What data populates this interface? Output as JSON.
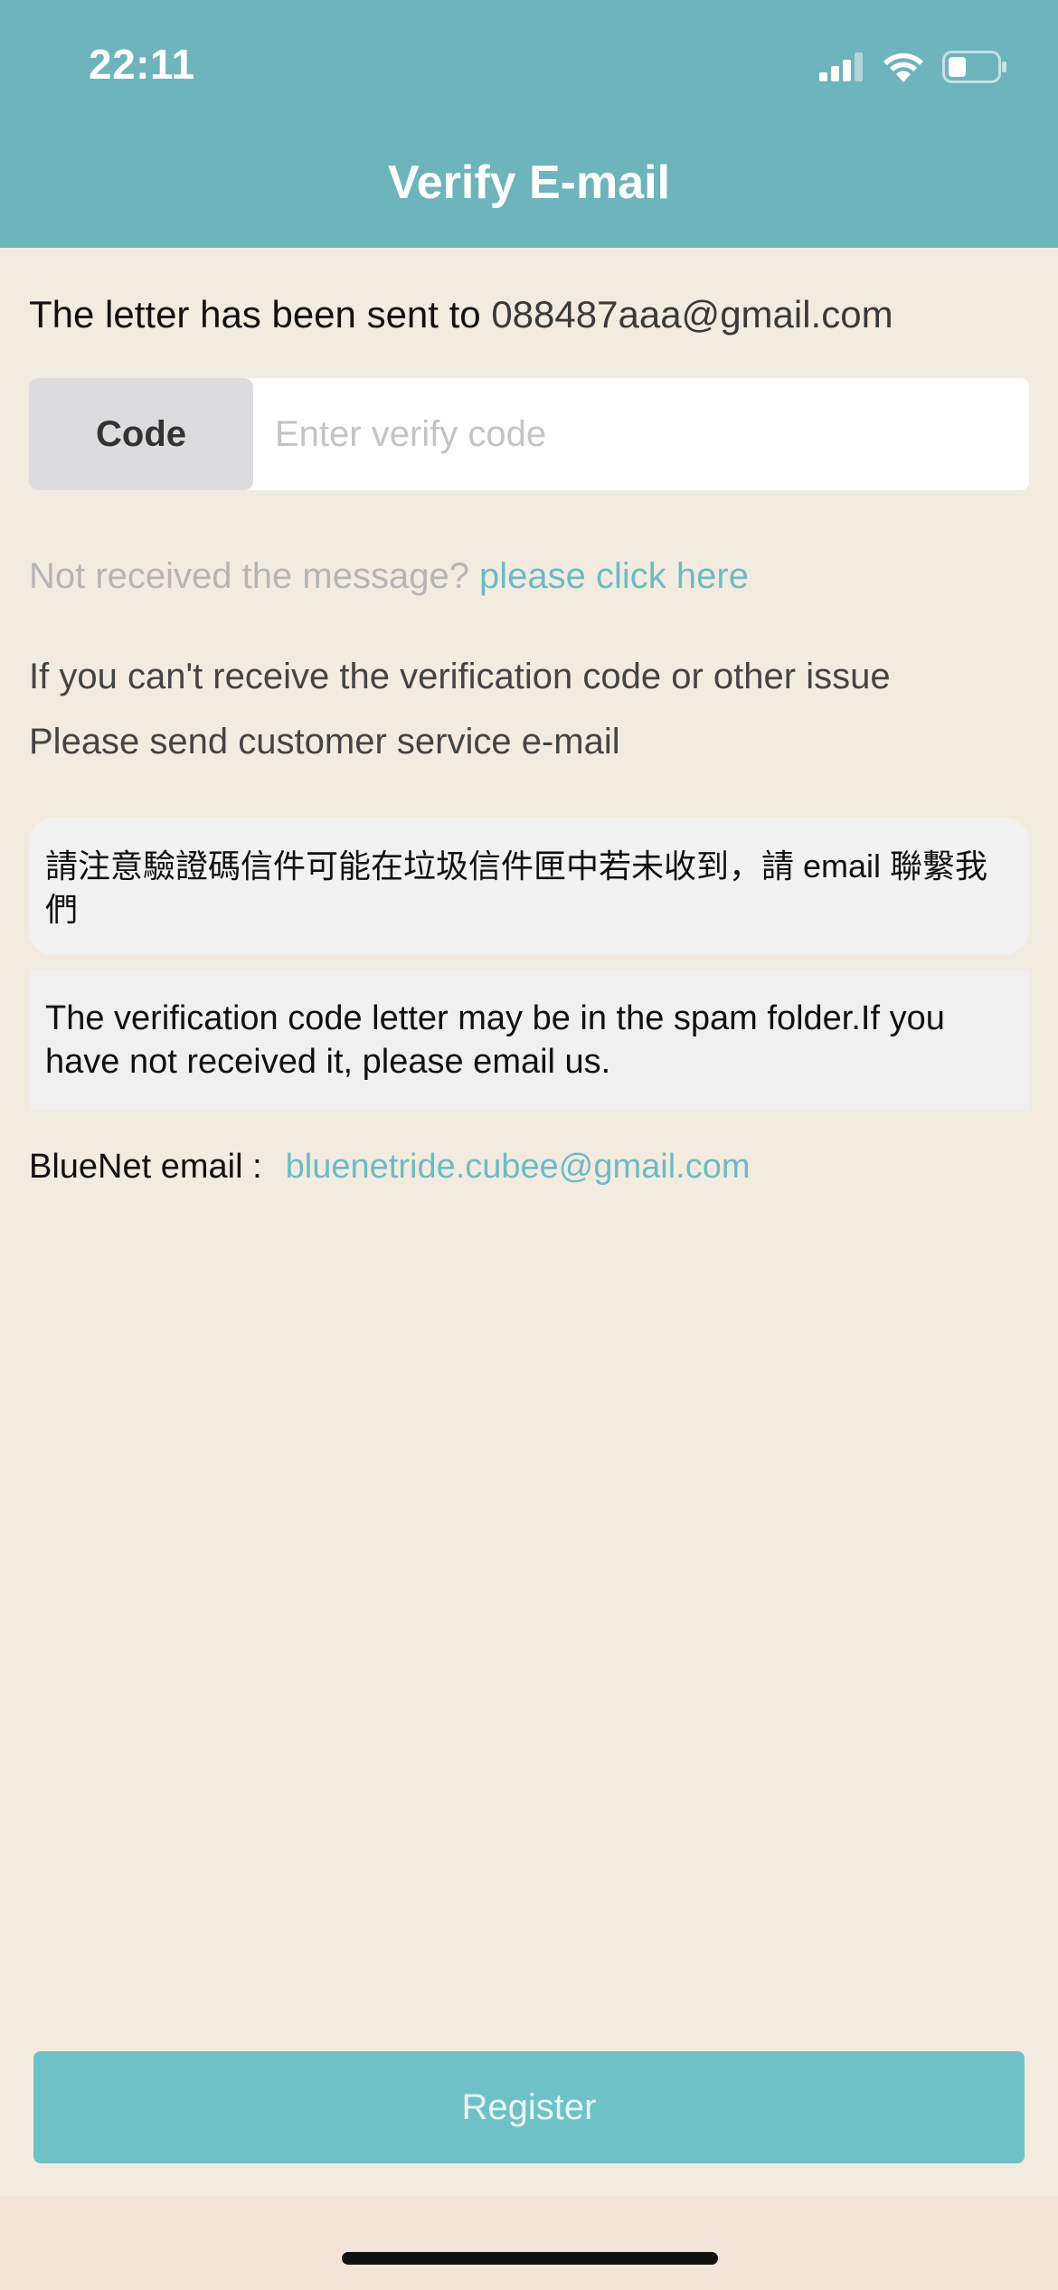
{
  "status_bar": {
    "time": "22:11"
  },
  "header": {
    "title": "Verify E-mail"
  },
  "sent_notice": {
    "prefix": "The letter has been sent to ",
    "email": "088487aaa@gmail.com"
  },
  "code_field": {
    "label": "Code",
    "placeholder": "Enter verify code",
    "value": ""
  },
  "resend": {
    "prompt": "Not received the message? ",
    "link": "please click here"
  },
  "help": {
    "line1": "If you can't receive the verification code or other issue",
    "line2": "Please send customer service e-mail"
  },
  "notice_zh": "請注意驗證碼信件可能在垃圾信件匣中若未收到，請 email 聯繫我們",
  "notice_en": "The verification code letter may be in the spam folder.If you have not received it, please email us.",
  "bluenet": {
    "label": "BlueNet email :",
    "email": "bluenetride.cubee@gmail.com"
  },
  "register_button": "Register",
  "colors": {
    "header_bg": "#6db4bc",
    "page_bg": "#f4ebe0",
    "accent": "#6ec2c7",
    "link": "#6cbcc4"
  },
  "icons": [
    "cellular-signal-icon",
    "wifi-icon",
    "battery-icon"
  ]
}
